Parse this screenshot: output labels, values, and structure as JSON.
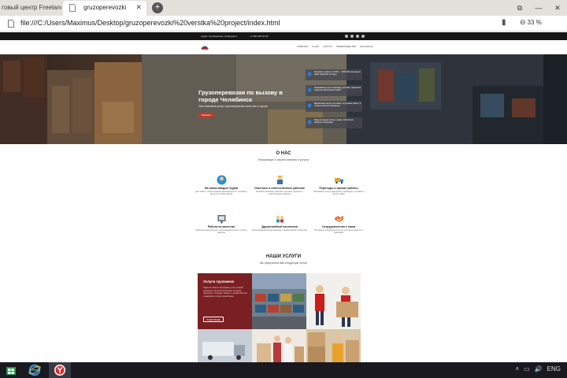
{
  "browser": {
    "tabs": [
      {
        "label": "говый центр Freelanc",
        "active": false
      },
      {
        "label": "gruzoperevozki",
        "active": true
      }
    ],
    "new_tab_label": "+",
    "url": "file:///C:/Users/Maximus/Desktop/gruzoperevozki%20verstka%20project/index.html",
    "zoom": "33 %",
    "window_controls": [
      "⧉",
      "—",
      "✕"
    ]
  },
  "site": {
    "topstrip": {
      "address": "Адрес: Челябинская, Лебедева 4",
      "phone": "+7 900 000 00 00"
    },
    "nav": [
      "Главная",
      "О нас",
      "Услуги",
      "Преимущества",
      "Контакты"
    ],
    "hero": {
      "title": "Грузоперевозки по вызову в городе Челябинск",
      "subtitle": "Уже компания услуг грузоперевозки качества и лучше",
      "button": "Заказать",
      "features": [
        {
          "text": "На связи с нами от с 8:00 — 18:00 Без выходных днём подробно по кругу"
        },
        {
          "text": "Оказываем услуги переезда, доставку перевозок отдельно включенных работ"
        },
        {
          "text": "Временные быстро на связи, отпускаем работу в течении быстрого времени"
        },
        {
          "text": "Рады сотрудничеству с нами, ответим на вопросы поддержки"
        }
      ]
    },
    "about": {
      "title": "О НАС",
      "subtitle": "Информация о нашей компании и услугах",
      "items": [
        {
          "heading": "На связи каждые будни",
          "desc": "Для связи с ответственным менеджером по телефону звоните в любое время"
        },
        {
          "heading": "Опытные и ответственные рабочие",
          "desc": "В нашей компании работают опытные грузчики и ответственные рабочие"
        },
        {
          "heading": "Переезды и прочие работы",
          "desc": "Оказываем услуги квартирных переездов, доставок и прочих работ"
        },
        {
          "heading": "Работа на качество",
          "desc": "Работаем на результат чтобы каждый клиент остался доволен"
        },
        {
          "heading": "Дружелюбный коллектив",
          "desc": "Наша команда всегда вежлива и внимательна к клиентам"
        },
        {
          "heading": "Сотрудничество с нами",
          "desc": "Выгодное сотрудничество для частных клиентов и компаний"
        }
      ]
    },
    "services": {
      "title": "НАШИ УСЛУГИ",
      "subtitle": "Мы предлагаем вам следующие услуги",
      "main_card": {
        "heading": "Услуги грузчиков",
        "desc": "Одна из самых популярных услуг нашей компании. Грузчики выполнят погрузку, разгрузку и перенос мебели и вещей быстро и аккуратно по доступной цене.",
        "button": "ПОДРОБНЕЕ"
      }
    }
  },
  "taskbar": {
    "apps": [
      "store-app",
      "edge-app",
      "yandex-app"
    ],
    "tray": [
      "˄",
      "▭",
      "🔊",
      "ENG"
    ]
  },
  "colors": {
    "accent": "#c0392b",
    "service_card": "#7a1f22",
    "topstrip": "#161616",
    "taskbar": "#19191f"
  }
}
